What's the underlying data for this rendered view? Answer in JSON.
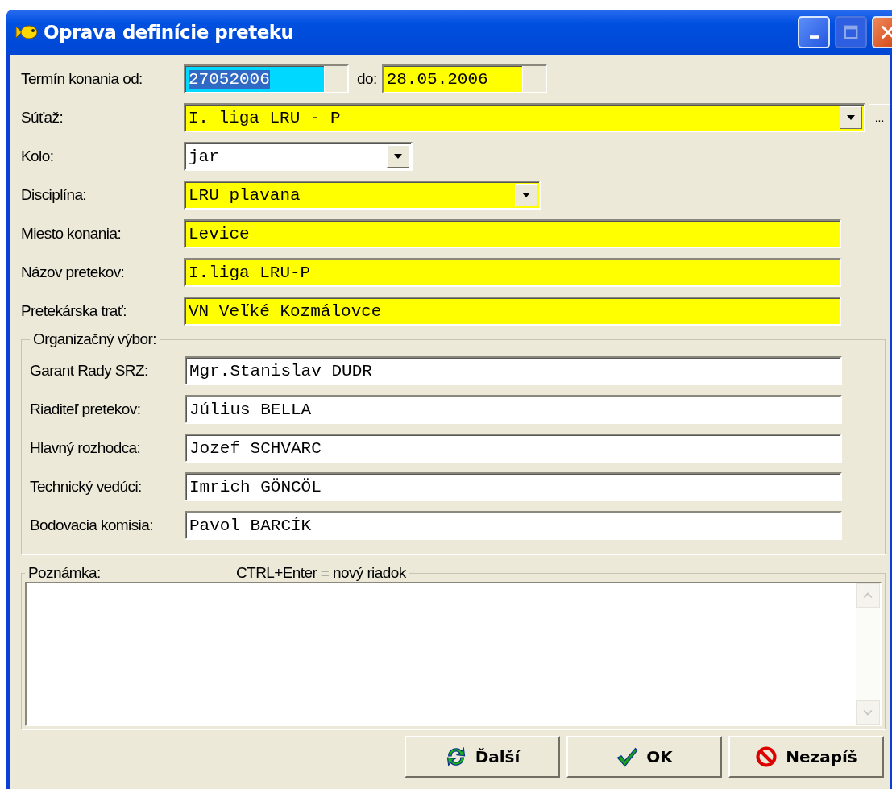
{
  "window": {
    "title": "Oprava definície preteku"
  },
  "date_row": {
    "label": "Termín konania od:",
    "from": {
      "value": "27052006",
      "focused": true
    },
    "to_label": "do:",
    "to": {
      "value": "28.05.2006",
      "focused": false,
      "required": true
    }
  },
  "fields": [
    {
      "label": "Súťaž:",
      "kind": "combo",
      "value": "I. liga LRU - P",
      "required": true,
      "browse_button": "..."
    },
    {
      "label": "Kolo:",
      "kind": "combo",
      "value": "jar",
      "required": false
    },
    {
      "label": "Disciplína:",
      "kind": "combo",
      "value": "LRU plavana",
      "required": true
    },
    {
      "label": "Miesto konania:",
      "kind": "text",
      "value": "Levice",
      "required": true
    },
    {
      "label": "Názov pretekov:",
      "kind": "text",
      "value": "I.liga LRU-P",
      "required": true
    },
    {
      "label": "Pretekárska trať:",
      "kind": "text",
      "value": "VN Veľké Kozmálovce",
      "required": true
    }
  ],
  "committee": {
    "legend": "Organizačný výbor:",
    "fields": [
      {
        "label": "Garant Rady SRZ:",
        "value": "Mgr.Stanislav DUDR"
      },
      {
        "label": "Riaditeľ pretekov:",
        "value": "Július BELLA"
      },
      {
        "label": "Hlavný rozhodca:",
        "value": "Jozef SCHVARC"
      },
      {
        "label": "Technický vedúci:",
        "value": "Imrich GÖNCÖL"
      },
      {
        "label": "Bodovacia komisia:",
        "value": "Pavol BARCÍK"
      }
    ]
  },
  "note": {
    "legend": "Poznámka:",
    "hint": "CTRL+Enter = nový riadok"
  },
  "buttons": [
    {
      "label": "Ďalší",
      "kind": "next"
    },
    {
      "label": "OK",
      "kind": "ok"
    },
    {
      "label": "Nezapíš",
      "kind": "cancel"
    }
  ]
}
